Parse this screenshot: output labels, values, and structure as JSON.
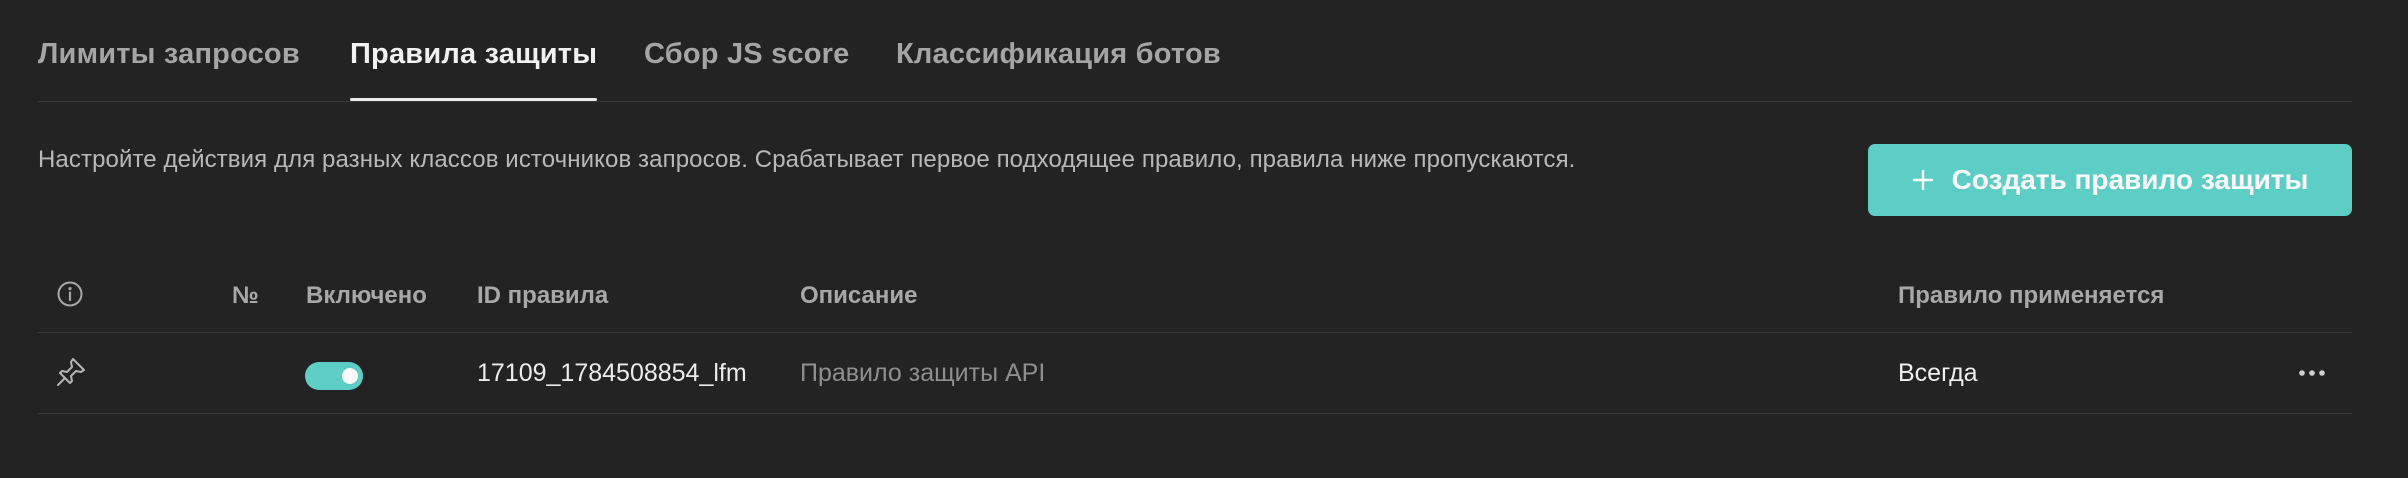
{
  "tabs": [
    {
      "label": "Лимиты запросов",
      "active": false
    },
    {
      "label": "Правила защиты",
      "active": true
    },
    {
      "label": "Сбор JS score",
      "active": false
    },
    {
      "label": "Классификация ботов",
      "active": false
    }
  ],
  "description": "Настройте действия для разных классов источников запросов. Срабатывает первое подходящее правило, правила ниже пропускаются.",
  "create_button": {
    "label": "Создать правило защиты",
    "icon": "plus-icon"
  },
  "table": {
    "columns": {
      "info_icon": "info-icon",
      "number": "№",
      "enabled": "Включено",
      "rule_id": "ID правила",
      "description": "Описание",
      "applies": "Правило применяется"
    },
    "rows": [
      {
        "pin_icon": "pin-icon",
        "number": "",
        "enabled": true,
        "rule_id": "17109_1784508854_lfm",
        "description": "Правило защиты API",
        "applies": "Всегда",
        "menu_icon": "more-horizontal-icon"
      }
    ]
  },
  "colors": {
    "background": "#232323",
    "accent": "#5dcec6",
    "text": "#e6e6e6",
    "muted": "#a5a5a5",
    "divider": "#373737"
  }
}
